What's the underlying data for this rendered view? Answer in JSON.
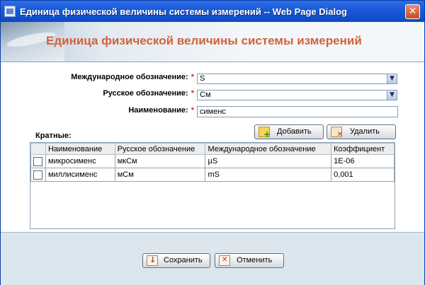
{
  "window": {
    "title": "Единица физической величины системы измерений -- Web Page Dialog",
    "close_glyph": "✕"
  },
  "banner": {
    "heading": "Единица физической величины системы измерений",
    "heading_color": "#d0623a"
  },
  "form": {
    "international": {
      "label": "Международное обозначение:",
      "value": "S"
    },
    "russian": {
      "label": "Русское обозначение:",
      "value": "См"
    },
    "name": {
      "label": "Наименование:",
      "value": "сименс"
    },
    "required_mark": "*",
    "dropdown_glyph": "▼"
  },
  "multiples": {
    "label": "Кратные:",
    "add_label": "Добавить",
    "delete_label": "Удалить",
    "columns": [
      "Наименование",
      "Русское обозначение",
      "Международное обозначение",
      "Коэффициент"
    ],
    "rows": [
      {
        "name": "микросименс",
        "russian": "мкСм",
        "international": "µS",
        "coefficient": "1E-06"
      },
      {
        "name": "миллисименс",
        "russian": "мСм",
        "international": "mS",
        "coefficient": "0,001"
      }
    ]
  },
  "footer": {
    "save_label": "Сохранить",
    "cancel_label": "Отменить"
  }
}
